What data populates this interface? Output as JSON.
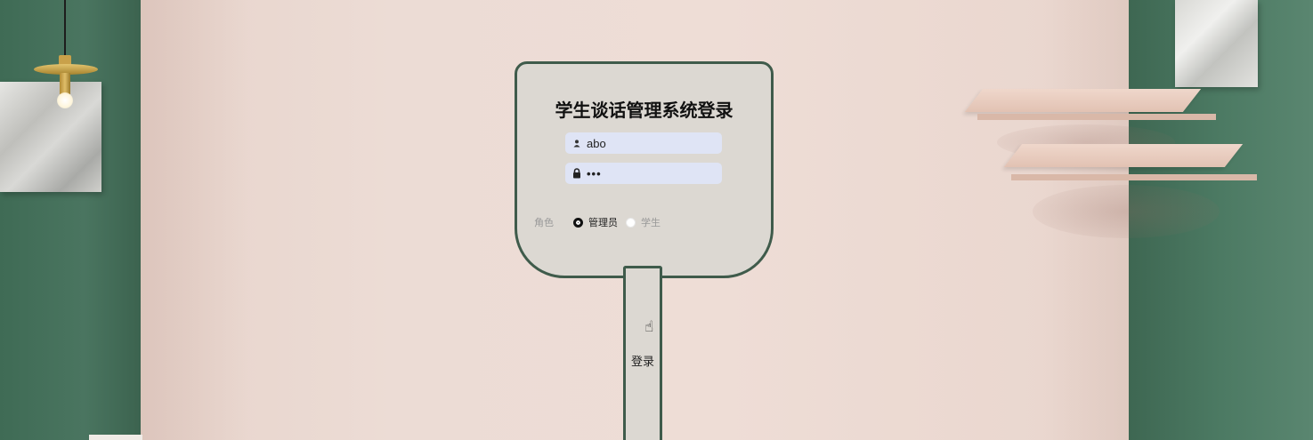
{
  "login": {
    "title": "学生谈话管理系统登录",
    "username": {
      "value": "abo",
      "icon": "user-icon"
    },
    "password": {
      "value": "•••",
      "icon": "lock-icon"
    },
    "role": {
      "label": "角色",
      "options": [
        {
          "label": "管理员",
          "checked": true
        },
        {
          "label": "学生",
          "checked": false
        }
      ]
    },
    "submit_label": "登录"
  },
  "colors": {
    "panel_bg": "#dcd8d2",
    "panel_border": "#3f5b4b",
    "input_bg": "#dfe4f5",
    "wall_green": "#4a7560",
    "wall_pink": "#ecdcd5"
  }
}
